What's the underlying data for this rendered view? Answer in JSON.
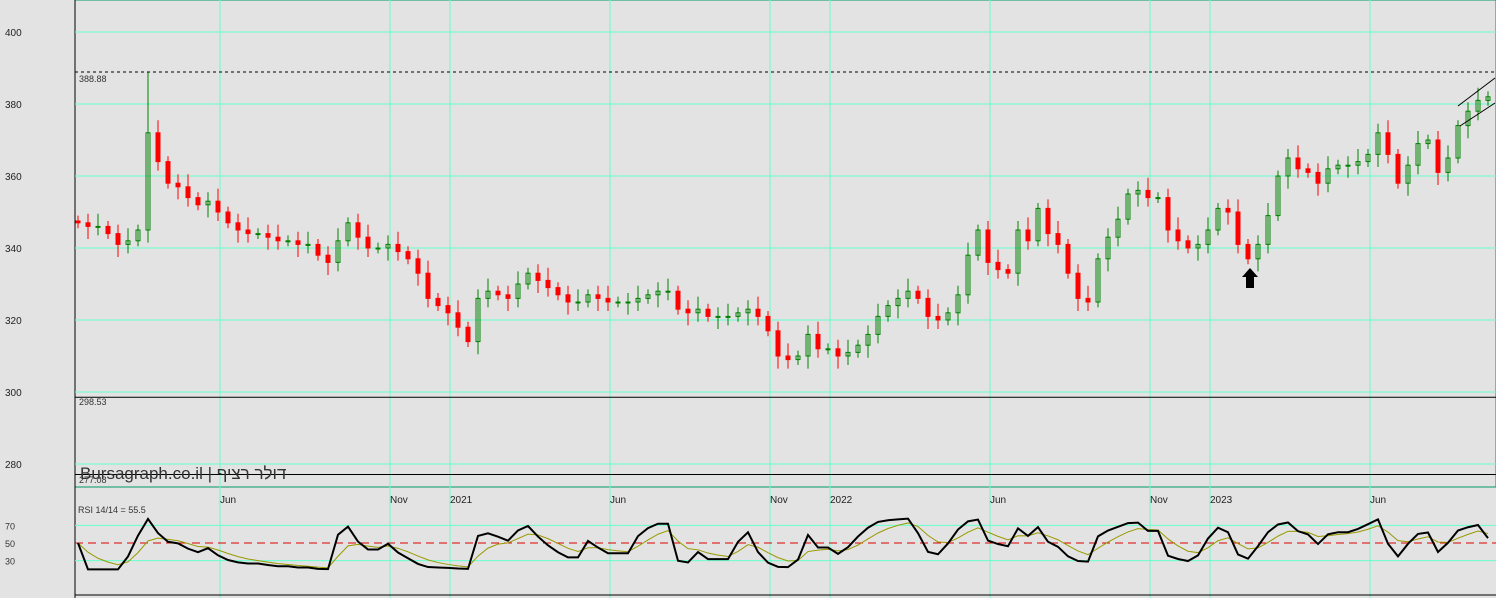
{
  "chart_data": {
    "type": "candlestick",
    "title": "Bursagraph.co.il | דולר רציף",
    "watermark": "Bursagraph.co.il | דולר רציף",
    "y_ticks": [
      400,
      380,
      360,
      340,
      320,
      300,
      280
    ],
    "ylim": [
      271,
      409
    ],
    "x_ticks": [
      {
        "label": "Jun",
        "index": 15
      },
      {
        "label": "Nov",
        "index": 32
      },
      {
        "label": "2021",
        "index": 38
      },
      {
        "label": "Jun",
        "index": 54
      },
      {
        "label": "Nov",
        "index": 70
      },
      {
        "label": "2022",
        "index": 76
      },
      {
        "label": "Jun",
        "index": 92
      },
      {
        "label": "Nov",
        "index": 108
      },
      {
        "label": "2023",
        "index": 114
      },
      {
        "label": "Jun",
        "index": 130
      }
    ],
    "max_label": "388.88",
    "max_value": 388.88,
    "level_lines": [
      {
        "label": "298.53",
        "value": 298.53
      },
      {
        "label": "277.08",
        "value": 277.08
      }
    ],
    "closes": [
      347,
      346,
      346,
      344,
      341,
      342,
      345,
      372,
      364,
      358,
      357,
      354,
      352,
      353,
      350,
      347,
      345,
      344,
      344,
      343,
      342,
      342,
      341,
      341,
      338,
      336,
      342,
      347,
      343,
      340,
      340,
      341,
      339,
      337,
      333,
      326,
      324,
      322,
      318,
      314,
      326,
      328,
      327,
      326,
      330,
      333,
      331,
      329,
      327,
      325,
      325,
      327,
      326,
      325,
      325,
      325,
      326,
      327,
      328,
      328,
      323,
      322,
      323,
      321,
      321,
      321,
      322,
      323,
      321,
      317,
      310,
      309,
      310,
      316,
      312,
      312,
      310,
      311,
      313,
      316,
      321,
      324,
      326,
      328,
      326,
      321,
      320,
      322,
      327,
      338,
      345,
      336,
      334,
      333,
      345,
      342,
      351,
      344,
      341,
      333,
      326,
      325,
      337,
      343,
      348,
      355,
      356,
      354,
      354,
      345,
      342,
      340,
      341,
      345,
      351,
      350,
      341,
      337,
      341,
      349,
      360,
      365,
      362,
      361,
      358,
      362,
      363,
      363,
      364,
      366,
      372,
      366,
      358,
      363,
      369,
      370,
      361,
      365,
      374,
      378,
      381,
      382
    ],
    "arrow_index": 117,
    "rsi": {
      "label": "RSI 14/14 = 55.5",
      "value": 55.5,
      "levels": [
        70,
        50,
        30
      ],
      "level_labels": [
        "70",
        "50",
        "30"
      ],
      "ylim": [
        0,
        100
      ]
    },
    "colors": {
      "up": "#008000",
      "down": "#ff0000",
      "grid": "#66ffcc",
      "bg": "#e3e3e3",
      "rsi": "#000000",
      "signal": "#999900",
      "mid": "#dd0000"
    }
  }
}
